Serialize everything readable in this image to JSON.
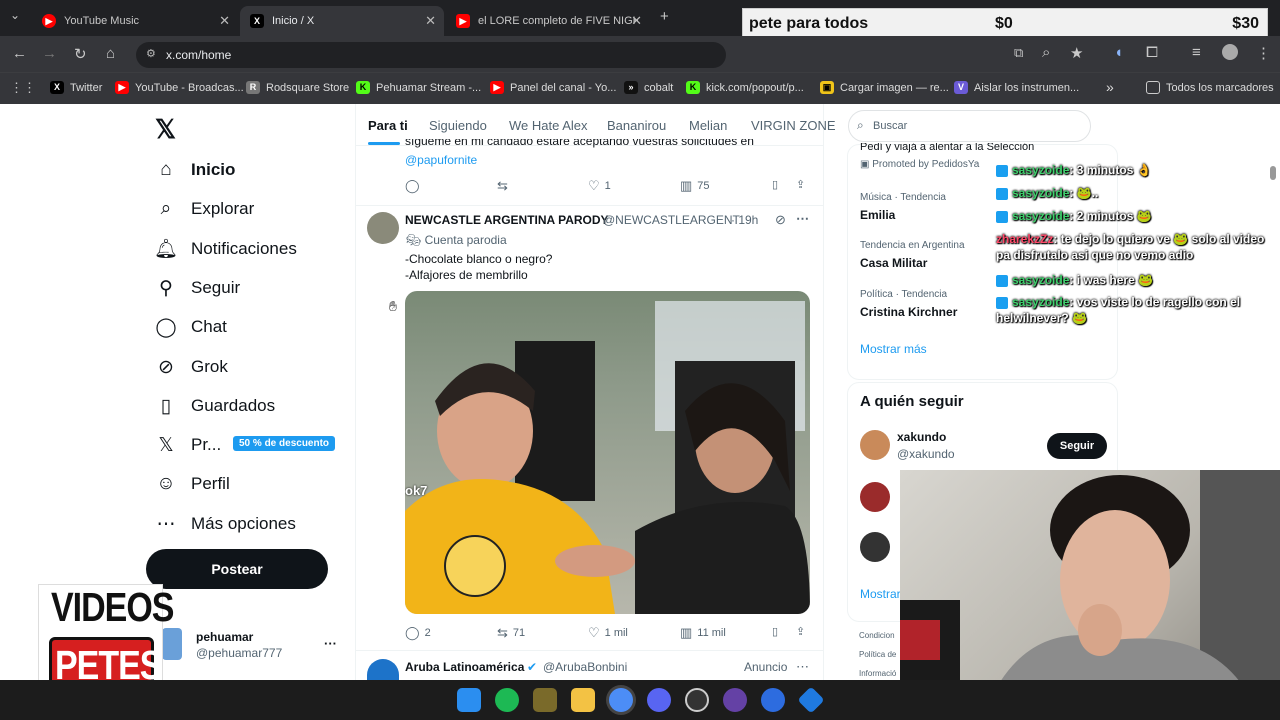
{
  "browser": {
    "tabs": [
      {
        "label": "YouTube Music",
        "active": false
      },
      {
        "label": "Inicio / X",
        "active": true
      },
      {
        "label": "el LORE completo de FIVE NIGH",
        "active": false
      }
    ],
    "new_tab": "+",
    "url": "x.com/home",
    "bookmarks": [
      {
        "label": "Twitter",
        "color": "#000000",
        "glyph": "X"
      },
      {
        "label": "YouTube - Broadcas...",
        "color": "#ff0000",
        "glyph": "▶"
      },
      {
        "label": "Rodsquare Store",
        "color": "#777777",
        "glyph": "R"
      },
      {
        "label": "Pehuamar Stream -...",
        "color": "#53fc18",
        "glyph": "K"
      },
      {
        "label": "Panel del canal - Yo...",
        "color": "#ff0000",
        "glyph": "▶"
      },
      {
        "label": "cobalt",
        "color": "#111111",
        "glyph": ">>"
      },
      {
        "label": "kick.com/popout/p...",
        "color": "#53fc18",
        "glyph": "K"
      },
      {
        "label": "Cargar imagen — re...",
        "color": "#f0c419",
        "glyph": "▣"
      },
      {
        "label": "Aislar los instrumen...",
        "color": "#6b5bd6",
        "glyph": "V"
      }
    ],
    "bookmarks_more": "»",
    "all_bookmarks": "Todos los marcadores"
  },
  "donation": {
    "name": "pete para todos",
    "amount_current": "$0",
    "amount_goal": "$30"
  },
  "x": {
    "logo": "𝕏",
    "nav": [
      {
        "label": "Inicio",
        "icon": "home-icon",
        "bold": true
      },
      {
        "label": "Explorar",
        "icon": "search-icon"
      },
      {
        "label": "Notificaciones",
        "icon": "bell-icon"
      },
      {
        "label": "Seguir",
        "icon": "add-user-icon"
      },
      {
        "label": "Chat",
        "icon": "chat-icon"
      },
      {
        "label": "Grok",
        "icon": "grok-icon"
      },
      {
        "label": "Guardados",
        "icon": "bookmark-icon"
      },
      {
        "label": "Pr...",
        "icon": "x-premium-icon"
      },
      {
        "label": "Perfil",
        "icon": "profile-icon"
      },
      {
        "label": "Más opciones",
        "icon": "more-icon"
      }
    ],
    "premium_badge": "50 % de descuento",
    "post_button": "Postear",
    "account": {
      "name": "pehuamar",
      "handle": "@pehuamar777",
      "more": "···"
    },
    "feed_tabs": [
      "Para ti",
      "Siguiendo",
      "We Hate Alex",
      "Bananirou",
      "Melian",
      "VIRGIN ZONE"
    ],
    "prev_tweet": {
      "text_partial": "sígueme en mi candado estaré aceptando vuestras solicitudes en",
      "mention": "@papufornite",
      "replies": "",
      "retweets": "",
      "likes": "1",
      "views": "75"
    },
    "tweet": {
      "name": "NEWCASTLE ARGENTINA PARODY",
      "handle": "@NEWCASTLEARGENT",
      "time": "· 19h",
      "label": "Cuenta parodia",
      "line1": "-Chocolate blanco o negro?",
      "line2": "-Alfajores de membrillo",
      "replies": "2",
      "retweets": "71",
      "likes": "1 mil",
      "views": "11 mil",
      "image_text": "ok7"
    },
    "next_tweet": {
      "name": "Aruba Latinoamérica",
      "handle": "@ArubaBonbini",
      "ad": "Anuncio"
    },
    "search_placeholder": "Buscar",
    "promo": {
      "line": "Pedí y viajá a alentar a la Selección",
      "promoted": "Promoted by PedidosYa"
    },
    "trends": [
      {
        "category": "Música · Tendencia",
        "name": "Emilia"
      },
      {
        "category": "Tendencia en Argentina",
        "name": "Casa Militar"
      },
      {
        "category": "Política · Tendencia",
        "name": "Cristina Kirchner"
      }
    ],
    "show_more": "Mostrar más",
    "who_to_follow_title": "A quién seguir",
    "follow": {
      "name": "xakundo",
      "handle": "@xakundo",
      "button": "Seguir"
    },
    "show_more_2": "Mostrar",
    "footer": [
      "Condicion",
      "Política de",
      "Informació"
    ]
  },
  "chat": [
    {
      "user": "sasyzoide",
      "msg": ": 3 minutos 👌"
    },
    {
      "user": "sasyzoide",
      "msg": ": 🐸.."
    },
    {
      "user": "sasyzoide",
      "msg": ": 2 minutos 🐸"
    },
    {
      "user": "zharekzZz",
      "msg": ": te dejo lo quiero ve 🐸 solo al video pa disfrutalo asi que no vemo adio"
    },
    {
      "user": "sasyzoide",
      "msg": ": i was here 🐸"
    },
    {
      "user": "sasyzoide",
      "msg": ": vos viste lo de ragello con el helwilnever? 🐸"
    }
  ],
  "overlay_logo": {
    "line1": "VIDEOS",
    "line2": "PETES"
  },
  "colors": {
    "accent": "#1d9bf0",
    "dark": "#0f1419",
    "muted": "#536471",
    "chrome": "#35363a"
  }
}
